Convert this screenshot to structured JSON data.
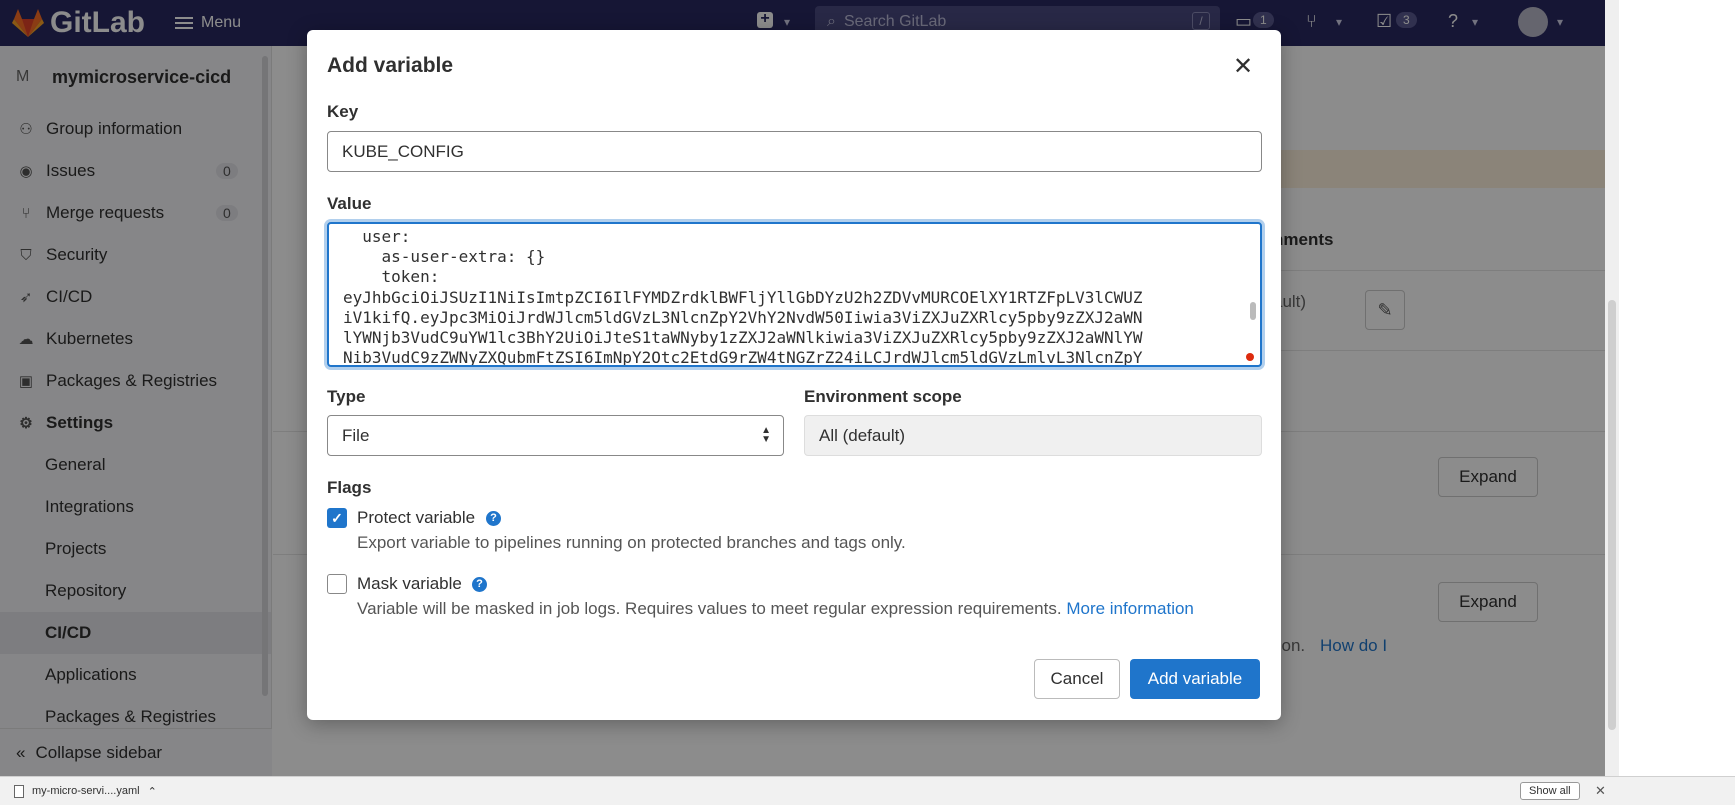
{
  "topbar": {
    "logo_text": "GitLab",
    "menu_label": "Menu",
    "search_placeholder": "Search GitLab",
    "search_shortcut": "/",
    "issues_count": "1",
    "todos_count": "3"
  },
  "sidebar": {
    "project_initial": "M",
    "project_name": "mymicroservice-cicd",
    "items": [
      {
        "label": "Group information",
        "icon": "group-icon"
      },
      {
        "label": "Issues",
        "icon": "issues-icon",
        "count": "0"
      },
      {
        "label": "Merge requests",
        "icon": "merge-request-icon",
        "count": "0"
      },
      {
        "label": "Security",
        "icon": "shield-icon"
      },
      {
        "label": "CI/CD",
        "icon": "rocket-icon"
      },
      {
        "label": "Kubernetes",
        "icon": "cloud-icon"
      },
      {
        "label": "Packages & Registries",
        "icon": "package-icon"
      },
      {
        "label": "Settings",
        "icon": "settings-icon"
      }
    ],
    "settings_sub": [
      "General",
      "Integrations",
      "Projects",
      "Repository",
      "CI/CD",
      "Applications",
      "Packages & Registries"
    ],
    "collapse_label": "Collapse sidebar"
  },
  "background": {
    "section_heading": "nments",
    "default_text": "ault)",
    "expand_label": "Expand",
    "note_text": "tion.",
    "note_link": "How do I"
  },
  "modal": {
    "title": "Add variable",
    "key_label": "Key",
    "key_value": "KUBE_CONFIG",
    "value_label": "Value",
    "value_text": "  user:\n    as-user-extra: {}\n    token:\neyJhbGciOiJSUzI1NiIsImtpZCI6IlFYMDZrdklBWFljYllGbDYzU2h2ZDVvMURCOElXY1RTZFpLV3lCWUZ\niV1kifQ.eyJpc3MiOiJrdWJlcm5ldGVzL3NlcnZpY2VhY2NvdW50Iiwia3ViZXJuZXRlcy5pby9zZXJ2aWN\nlYWNjb3VudC9uYW1lc3BhY2UiOiJteS1taWNyby1zZXJ2aWNlkiwia3ViZXJuZXRlcy5pby9zZXJ2aWNlYW\nNib3VudC9zZWNyZXQubmFtZSI6ImNpY2Otc2EtdG9rZW4tNGZrZ24iLCJrdWJlcm5ldGVzLmlvL3NlcnZpY",
    "type_label": "Type",
    "type_value": "File",
    "env_label": "Environment scope",
    "env_value": "All (default)",
    "flags_label": "Flags",
    "protect": {
      "label": "Protect variable",
      "checked": true,
      "description": "Export variable to pipelines running on protected branches and tags only."
    },
    "mask": {
      "label": "Mask variable",
      "checked": false,
      "description": "Variable will be masked in job logs. Requires values to meet regular expression requirements.",
      "link": "More information"
    },
    "cancel_label": "Cancel",
    "submit_label": "Add variable"
  },
  "downloads": {
    "file_name": "my-micro-servi....yaml",
    "show_all": "Show all"
  },
  "colors": {
    "topbar": "#292961",
    "primary": "#1f75cb",
    "error_dot": "#dd2b0e"
  }
}
